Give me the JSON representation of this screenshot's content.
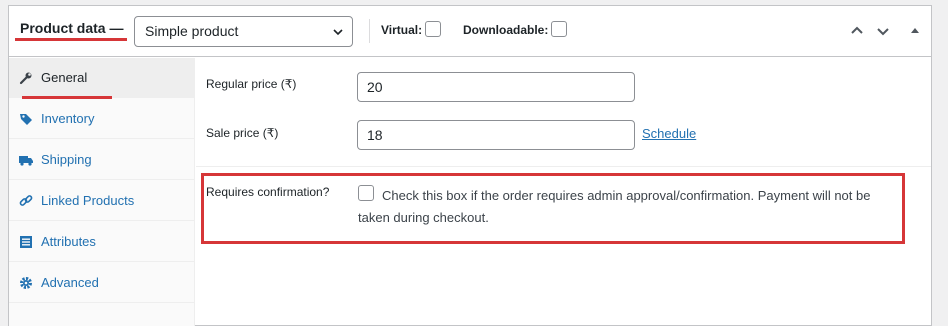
{
  "header": {
    "title": "Product data —",
    "product_type": "Simple product",
    "virtual_label": "Virtual:",
    "downloadable_label": "Downloadable:"
  },
  "sidebar": {
    "items": [
      {
        "label": "General",
        "icon": "wrench-icon",
        "active": true
      },
      {
        "label": "Inventory",
        "icon": "tag-icon"
      },
      {
        "label": "Shipping",
        "icon": "truck-icon"
      },
      {
        "label": "Linked Products",
        "icon": "link-icon"
      },
      {
        "label": "Attributes",
        "icon": "list-icon"
      },
      {
        "label": "Advanced",
        "icon": "gear-icon"
      }
    ]
  },
  "general": {
    "regular_price_label": "Regular price (₹)",
    "regular_price_value": "20",
    "sale_price_label": "Sale price (₹)",
    "sale_price_value": "18",
    "schedule_link": "Schedule",
    "requires_confirmation_label": "Requires confirmation?",
    "requires_confirmation_desc": "Check this box if the order requires admin approval/confirmation. Payment will not be taken during checkout."
  },
  "colors": {
    "accent": "#2271b1",
    "highlight": "#d63638"
  }
}
